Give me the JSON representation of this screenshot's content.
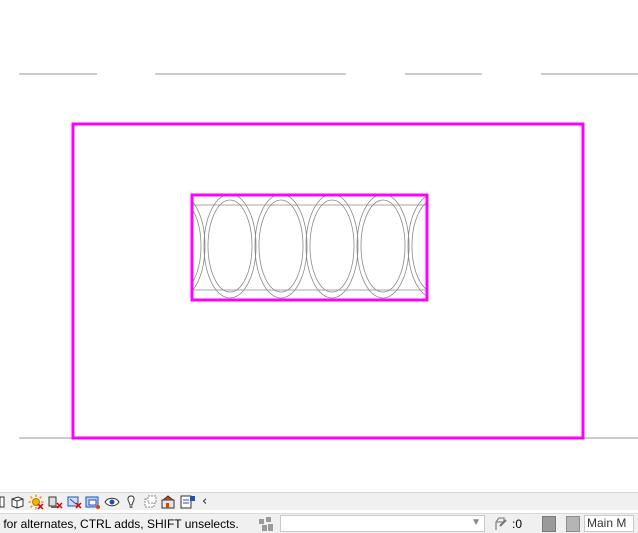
{
  "drawing": {
    "selection_color": "#ff00ff",
    "line_color": "#8a8a8a"
  },
  "view_control_bar": {
    "icons": [
      "scale-icon",
      "visual-style-icon",
      "sun-path-icon",
      "shadows-icon",
      "crop-view-icon",
      "show-crop-region-icon",
      "temporary-hide-isolate-icon",
      "reveal-hidden-elements-icon",
      "temporary-view-properties-icon",
      "analysis-display-icon",
      "highlight-displacement-icon",
      "constraints-icon"
    ],
    "collapse_glyph": "‹"
  },
  "status_bar": {
    "message": "B for alternates, CTRL adds, SHIFT unselects.",
    "workset_value": "",
    "editable_count": ":0",
    "design_option": "Main M"
  }
}
